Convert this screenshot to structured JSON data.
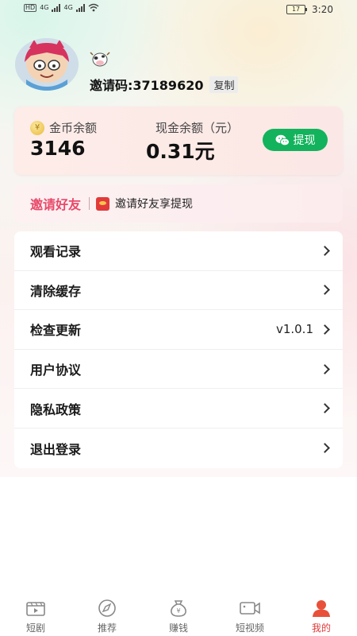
{
  "status_bar": {
    "time": "3:20",
    "battery": "17",
    "network": "4G",
    "hd": "HD"
  },
  "profile": {
    "invite_code": "邀请码:37189620",
    "copy_label": "复制"
  },
  "balance": {
    "coin_label": "金币余额",
    "coin_value": "3146",
    "cash_label": "现金余额（元）",
    "cash_value": "0.31元",
    "withdraw_label": "提现"
  },
  "invite": {
    "title": "邀请好友",
    "subtitle": "邀请好友享提现"
  },
  "menu": {
    "items": [
      {
        "label": "观看记录",
        "value": ""
      },
      {
        "label": "清除缓存",
        "value": ""
      },
      {
        "label": "检查更新",
        "value": "v1.0.1"
      },
      {
        "label": "用户协议",
        "value": ""
      },
      {
        "label": "隐私政策",
        "value": ""
      },
      {
        "label": "退出登录",
        "value": ""
      }
    ]
  },
  "tabbar": {
    "tabs": [
      {
        "label": "短剧",
        "icon": "play-screen-icon"
      },
      {
        "label": "推荐",
        "icon": "compass-icon"
      },
      {
        "label": "赚钱",
        "icon": "money-bag-icon"
      },
      {
        "label": "短视频",
        "icon": "video-camera-icon"
      },
      {
        "label": "我的",
        "icon": "user-icon"
      }
    ],
    "active_index": 4
  },
  "colors": {
    "accent_red": "#e23a3a",
    "withdraw_green": "#12b35c",
    "invite_pink": "#e8496a"
  }
}
